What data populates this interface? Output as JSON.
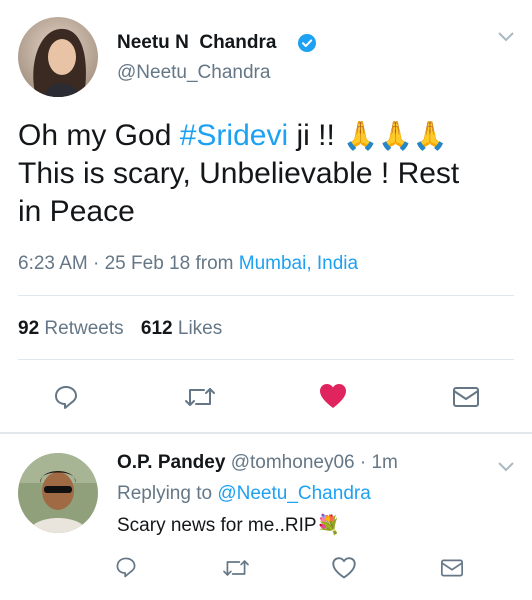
{
  "tweet": {
    "author_name": "Neetu N  Chandra",
    "author_handle": "@Neetu_Chandra",
    "verified": true,
    "text_before": "Oh my God ",
    "hashtag": "#Sridevi",
    "text_after": " ji !! ",
    "emoji": "🙏🙏🙏",
    "text_line2": "This is scary, Unbelievable ! Rest",
    "text_line3": "in Peace",
    "time": "6:23 AM",
    "dot": "·",
    "date": "25 Feb 18",
    "from_label": "from",
    "location": "Mumbai, India",
    "retweets_count": "92",
    "retweets_label": "Retweets",
    "likes_count": "612",
    "likes_label": "Likes",
    "liked": true
  },
  "reply": {
    "author_name": "O.P. Pandey",
    "author_handle": "@tomhoney06",
    "dot": "·",
    "time_ago": "1m",
    "replying_label": "Replying to",
    "replying_handle": "@Neetu_Chandra",
    "text": "Scary news for me..RIP",
    "emoji": "💐"
  },
  "colors": {
    "accent": "#1da1f2",
    "like_red": "#e0245e",
    "secondary": "#657786",
    "divider": "#e1e8ed"
  },
  "icons": [
    "chevron-down-icon",
    "verified-badge-icon",
    "reply-icon",
    "retweet-icon",
    "heart-icon",
    "message-icon"
  ]
}
